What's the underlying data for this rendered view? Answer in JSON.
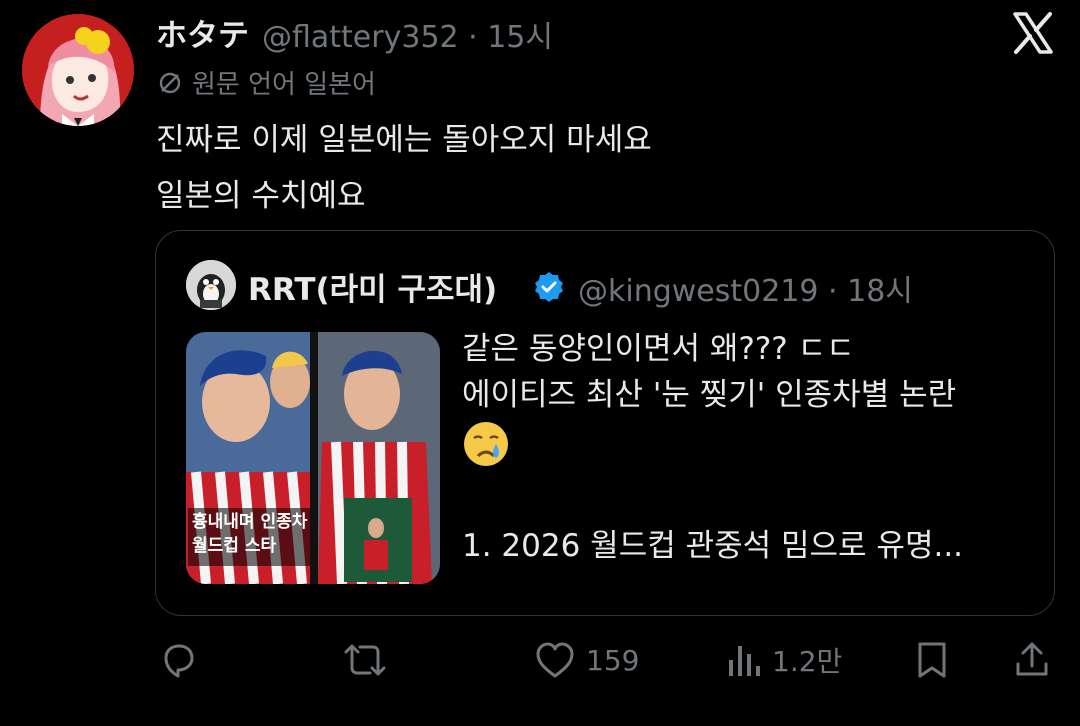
{
  "tweet": {
    "display_name": "ホタテ",
    "handle_time": "@flattery352 · 15시",
    "translation_label": "원문 언어 일본어",
    "body_lines": [
      "진짜로 이제 일본에는 돌아오지 마세요",
      "일본의 수치예요"
    ]
  },
  "quote": {
    "display_name": "RRT(라미 구조대)",
    "handle_time": "@kingwest0219 · 18시",
    "text_line1": "같은 동양인이면서 왜??? ㄷㄷ",
    "text_line2": "에이티즈 최산 '눈 찢기' 인종차별 논란",
    "text_point": "1. 2026 월드컵 관중석 밈으로 유명...",
    "media_caption_line1": "흉내내며 인종차",
    "media_caption_line2": "월드컵 스타"
  },
  "actions": {
    "likes": "159",
    "views": "1.2만"
  },
  "colors": {
    "background": "#000000",
    "text": "#e7e9ea",
    "muted": "#71767b",
    "border": "#2f3336",
    "verified": "#1d9bf0"
  },
  "icons": [
    "x-logo-icon",
    "translate-icon",
    "verified-badge-icon",
    "crying-face-emoji-icon",
    "reply-icon",
    "repost-icon",
    "like-icon",
    "views-icon",
    "bookmark-icon",
    "share-icon"
  ]
}
